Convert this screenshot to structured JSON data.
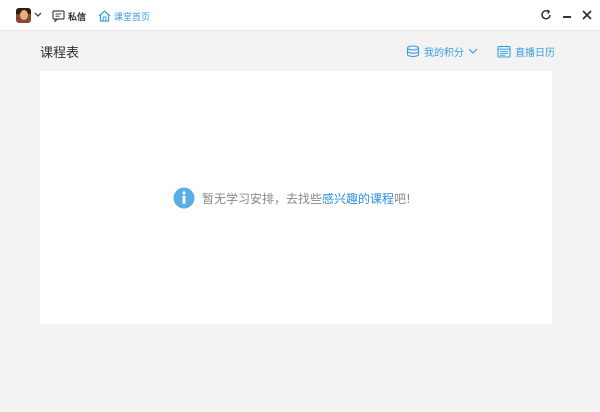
{
  "titlebar": {
    "message_label": "私信",
    "home_label": "课堂首页"
  },
  "header": {
    "title": "课程表",
    "points_label": "我的积分",
    "calendar_label": "直播日历"
  },
  "empty_state": {
    "prefix": "暂无学习安排，去找些",
    "link": "感兴趣的课程",
    "suffix": "吧!"
  },
  "colors": {
    "accent": "#3a9de0",
    "background": "#f3f3f3",
    "panel": "#ffffff"
  },
  "icons": {
    "message": "message-icon",
    "home": "home-icon",
    "coins": "coins-icon",
    "calendar": "calendar-icon",
    "info": "info-icon",
    "refresh": "refresh-icon",
    "minimize": "minimize-icon",
    "close": "close-icon"
  }
}
